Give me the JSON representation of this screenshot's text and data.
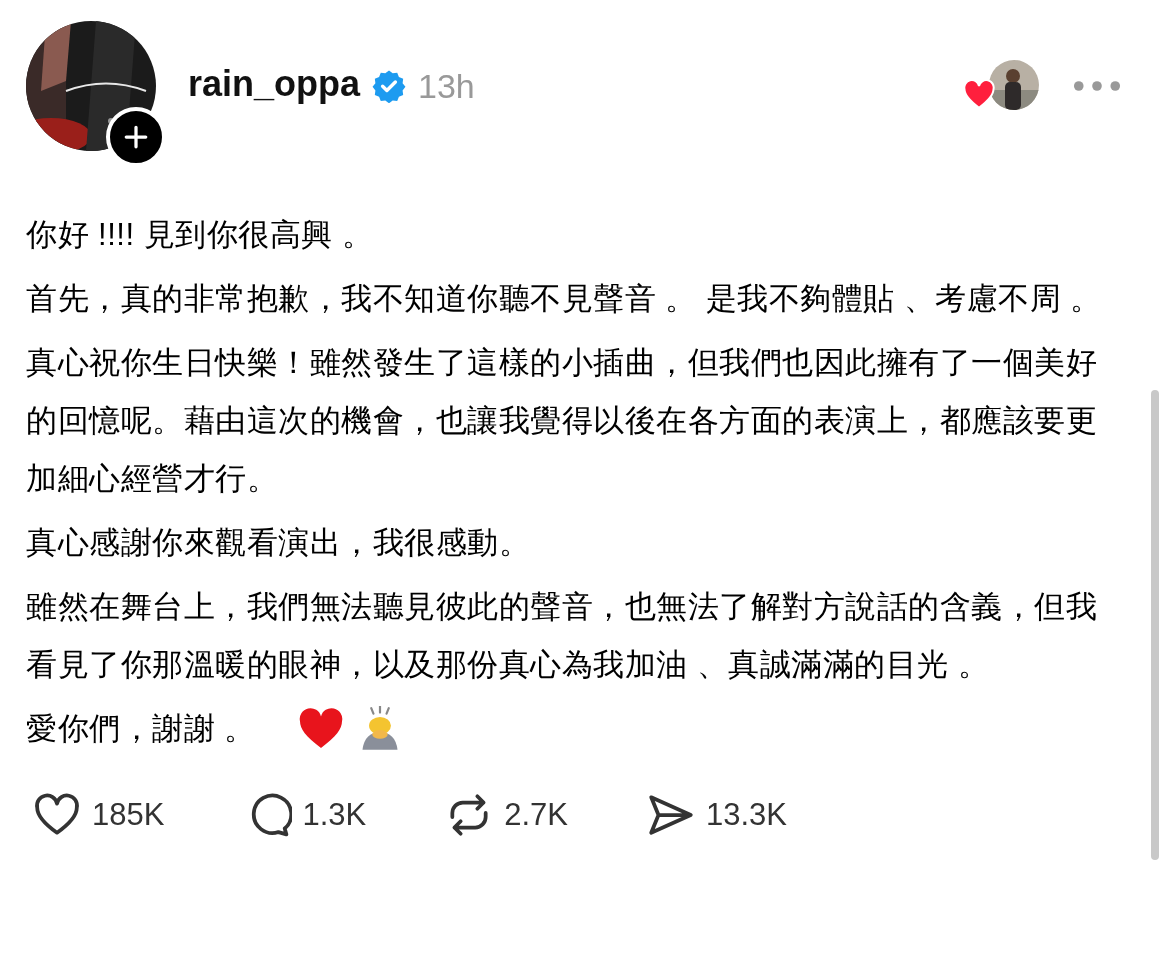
{
  "post": {
    "username": "rain_oppa",
    "verified": true,
    "time": "13h",
    "paragraphs": [
      "你好 !!!! 見到你很高興 。",
      "首先，真的非常抱歉，我不知道你聽不見聲音 。 是我不夠體貼 、考慮不周 。",
      "真心祝你生日快樂！雖然發生了這樣的小插曲，但我們也因此擁有了一個美好的回憶呢。藉由這次的機會，也讓我覺得以後在各方面的表演上，都應該要更加細心經營才行。",
      "真心感謝你來觀看演出，我很感動。",
      "雖然在舞台上，我們無法聽見彼此的聲音，也無法了解對方說話的含義，但我看見了你那溫暖的眼神，以及那份真心為我加油 、真誠滿滿的目光 。",
      "愛你們，謝謝 。"
    ],
    "actions": [
      {
        "kind": "like",
        "count": "185K"
      },
      {
        "kind": "comment",
        "count": "1.3K"
      },
      {
        "kind": "repost",
        "count": "2.7K"
      },
      {
        "kind": "share",
        "count": "13.3K"
      }
    ]
  }
}
